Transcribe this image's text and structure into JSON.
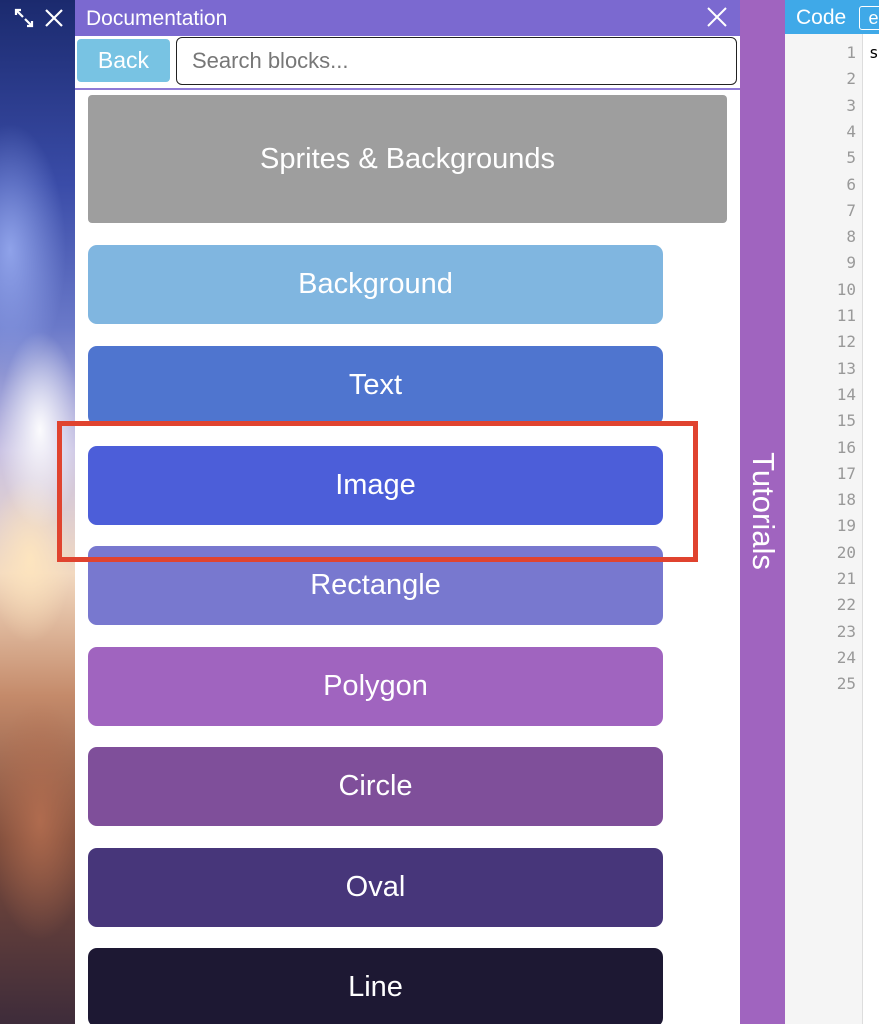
{
  "documentation": {
    "title": "Documentation",
    "back_label": "Back",
    "search_placeholder": "Search blocks...",
    "category": "Sprites & Backgrounds",
    "blocks": [
      {
        "label": "Background",
        "color": "#80b6e0"
      },
      {
        "label": "Text",
        "color": "#4f75cf"
      },
      {
        "label": "Image",
        "color": "#4c5ed9"
      },
      {
        "label": "Rectangle",
        "color": "#7878cf"
      },
      {
        "label": "Polygon",
        "color": "#a064bf"
      },
      {
        "label": "Circle",
        "color": "#7f4f9a"
      },
      {
        "label": "Oval",
        "color": "#47367a"
      },
      {
        "label": "Line",
        "color": "#1d1833"
      }
    ],
    "highlighted_block": "Image",
    "highlight_color": "#e0432f",
    "header_color": "#7b69d0"
  },
  "tutorials": {
    "label": "Tutorials",
    "color": "#a064bf"
  },
  "code": {
    "title": "Code",
    "edit_label": "e",
    "first_line_text": "s",
    "line_numbers": [
      "1",
      "2",
      "3",
      "4",
      "5",
      "6",
      "7",
      "8",
      "9",
      "10",
      "11",
      "12",
      "13",
      "14",
      "15",
      "16",
      "17",
      "18",
      "19",
      "20",
      "21",
      "22",
      "23",
      "24",
      "25"
    ],
    "header_color": "#3fa9e8"
  },
  "preview_toolbar": {
    "icons": [
      "expand-icon",
      "close-icon"
    ]
  }
}
